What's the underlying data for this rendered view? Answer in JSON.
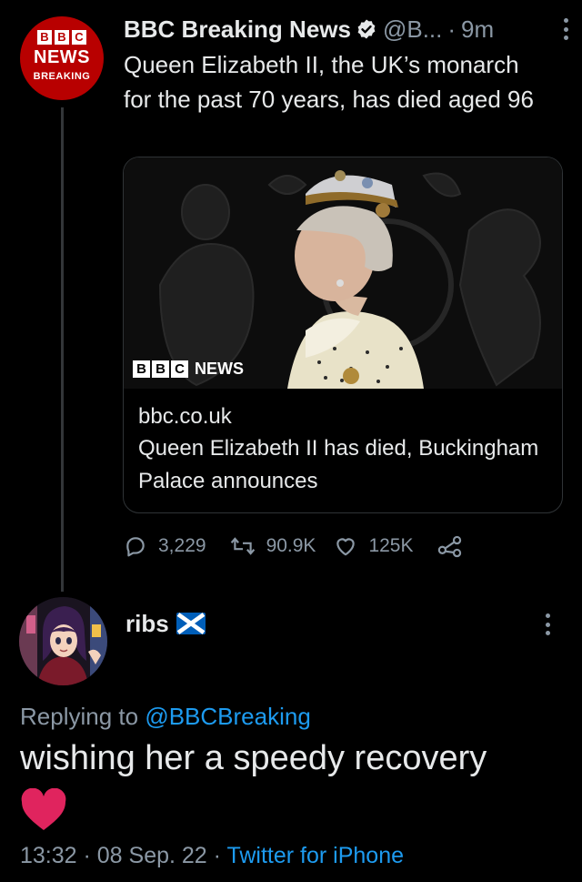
{
  "tweet": {
    "avatar": {
      "line1": [
        "B",
        "B",
        "C"
      ],
      "line2": "NEWS",
      "line3": "BREAKING"
    },
    "author_name": "BBC Breaking News",
    "handle": "@B...",
    "separator": "·",
    "time": "9m",
    "text": "Queen Elizabeth II, the UK’s monarch for the past 70 years, has died aged 96",
    "card": {
      "logo_blocks": [
        "B",
        "B",
        "C"
      ],
      "logo_text": "NEWS",
      "domain": "bbc.co.uk",
      "title": "Queen Elizabeth II has died, Buckingham Palace announces"
    },
    "stats": {
      "replies": "3,229",
      "retweets": "90.9K",
      "likes": "125K"
    }
  },
  "reply": {
    "author_name": "ribs",
    "replying_prefix": "Replying to",
    "replying_to": "@BBCBreaking",
    "text": "wishing her a speedy recovery",
    "meta_time": "13:32 · 08 Sep. 22 ·",
    "meta_source": "Twitter for iPhone"
  },
  "icons": {
    "verified": "verified-badge-icon",
    "more": "more-vertical-icon",
    "reply": "reply-icon",
    "retweet": "retweet-icon",
    "like": "heart-icon",
    "share": "share-icon",
    "flag": "scotland-flag-icon",
    "heart_emoji": "red-heart-icon"
  },
  "colors": {
    "background": "#000000",
    "text": "#e7e9ea",
    "secondary": "#8b98a5",
    "link": "#1d9bf0",
    "bbc_red": "#b80000",
    "heart_red": "#e0245e"
  }
}
